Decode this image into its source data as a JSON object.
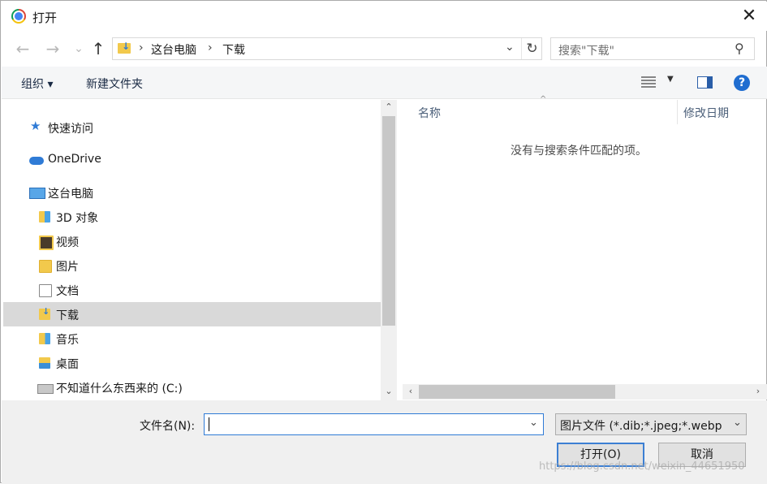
{
  "window": {
    "title": "打开",
    "close_glyph": "✕"
  },
  "nav": {
    "back_glyph": "←",
    "forward_glyph": "→",
    "recent_glyph": "⌄",
    "up_glyph": "↑",
    "breadcrumbs": [
      "这台电脑",
      "下载"
    ],
    "crumb_sep": "›",
    "dropdown_glyph": "⌄",
    "refresh_glyph": "↻"
  },
  "search": {
    "placeholder": "搜索\"下载\"",
    "icon_glyph": "⚲"
  },
  "toolbar": {
    "organize_label": "组织 ▾",
    "new_folder_label": "新建文件夹",
    "view_dropdown_glyph": "▼",
    "help_glyph": "?"
  },
  "tree": {
    "items": [
      {
        "label": "快速访问",
        "icon": "star-icon"
      },
      {
        "label": "OneDrive",
        "icon": "cloud-icon"
      },
      {
        "label": "这台电脑",
        "icon": "computer-icon"
      },
      {
        "label": "3D 对象",
        "icon": "3d-objects-folder-icon"
      },
      {
        "label": "视频",
        "icon": "videos-folder-icon"
      },
      {
        "label": "图片",
        "icon": "pictures-folder-icon"
      },
      {
        "label": "文档",
        "icon": "documents-folder-icon"
      },
      {
        "label": "下载",
        "icon": "downloads-folder-icon",
        "selected": true
      },
      {
        "label": "音乐",
        "icon": "music-folder-icon"
      },
      {
        "label": "桌面",
        "icon": "desktop-folder-icon"
      },
      {
        "label": "不知道什么东西来的 (C:)",
        "icon": "drive-icon"
      }
    ],
    "star_glyph": "★",
    "scroll_up_glyph": "⌃",
    "scroll_down_glyph": "⌄"
  },
  "content": {
    "columns": [
      "名称",
      "修改日期"
    ],
    "sort_glyph": "^",
    "empty_message": "没有与搜索条件匹配的项。",
    "scroll_left_glyph": "‹",
    "scroll_right_glyph": "›"
  },
  "footer": {
    "filename_label": "文件名(N):",
    "filename_value": "",
    "filetype_value": "图片文件 (*.dib;*.jpeg;*.webp",
    "dropdown_glyph": "⌄",
    "open_label": "打开(O)",
    "cancel_label": "取消"
  },
  "watermark": "https://blog.csdn.net/weixin_44651950",
  "colors": {
    "accent": "#2f7bd6",
    "selection": "#d9d9d9",
    "toolbar_bg": "#f5f6f7",
    "footer_bg": "#f0f0f0"
  }
}
